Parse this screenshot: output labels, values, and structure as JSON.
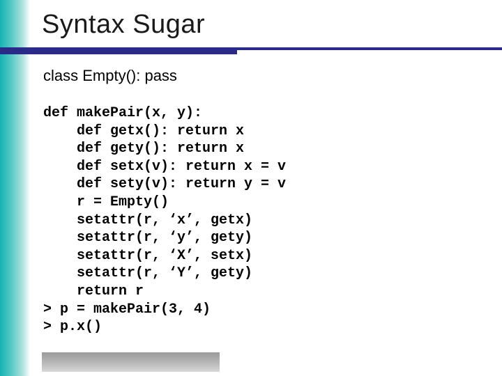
{
  "slide": {
    "title": "Syntax Sugar",
    "class_line": "class Empty(): pass",
    "code_lines": [
      "def makePair(x, y):",
      "    def getx(): return x",
      "    def gety(): return x",
      "    def setx(v): return x = v",
      "    def sety(v): return y = v",
      "    r = Empty()",
      "    setattr(r, ‘x’, getx)",
      "    setattr(r, ‘y’, gety)",
      "    setattr(r, ‘X’, setx)",
      "    setattr(r, ‘Y’, gety)",
      "    return r",
      "> p = makePair(3, 4)",
      "> p.x()"
    ]
  }
}
